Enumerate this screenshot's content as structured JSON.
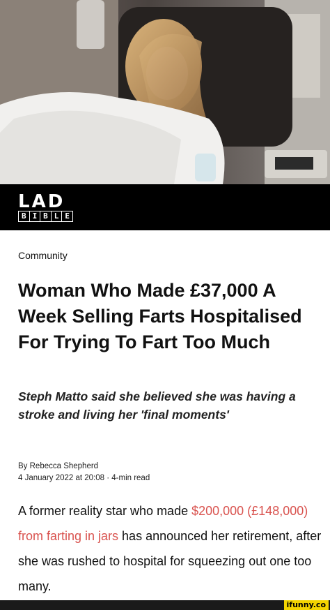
{
  "brand": {
    "logo_top": "LAD",
    "logo_bottom": [
      "B",
      "I",
      "B",
      "L",
      "E"
    ]
  },
  "article": {
    "category": "Community",
    "headline": "Woman Who Made £37,000 A Week Selling Farts Hospitalised For Trying To Fart Too Much",
    "subheadline": "Steph Matto said she believed she was having a stroke and living her 'final moments'",
    "author": "By Rebecca Shepherd",
    "meta": "4 January 2022 at 20:08 · 4-min read",
    "body": {
      "before": "A former reality star who made ",
      "link_text": "$200,000 (£148,000) from farting in jars",
      "after": " has announced her retirement, after she was rushed to hospital for squeezing out one too many."
    }
  },
  "watermark": "ifunny.co",
  "colors": {
    "link": "#d9534f",
    "brand_bar": "#000000",
    "watermark_bg": "#f4d400"
  }
}
